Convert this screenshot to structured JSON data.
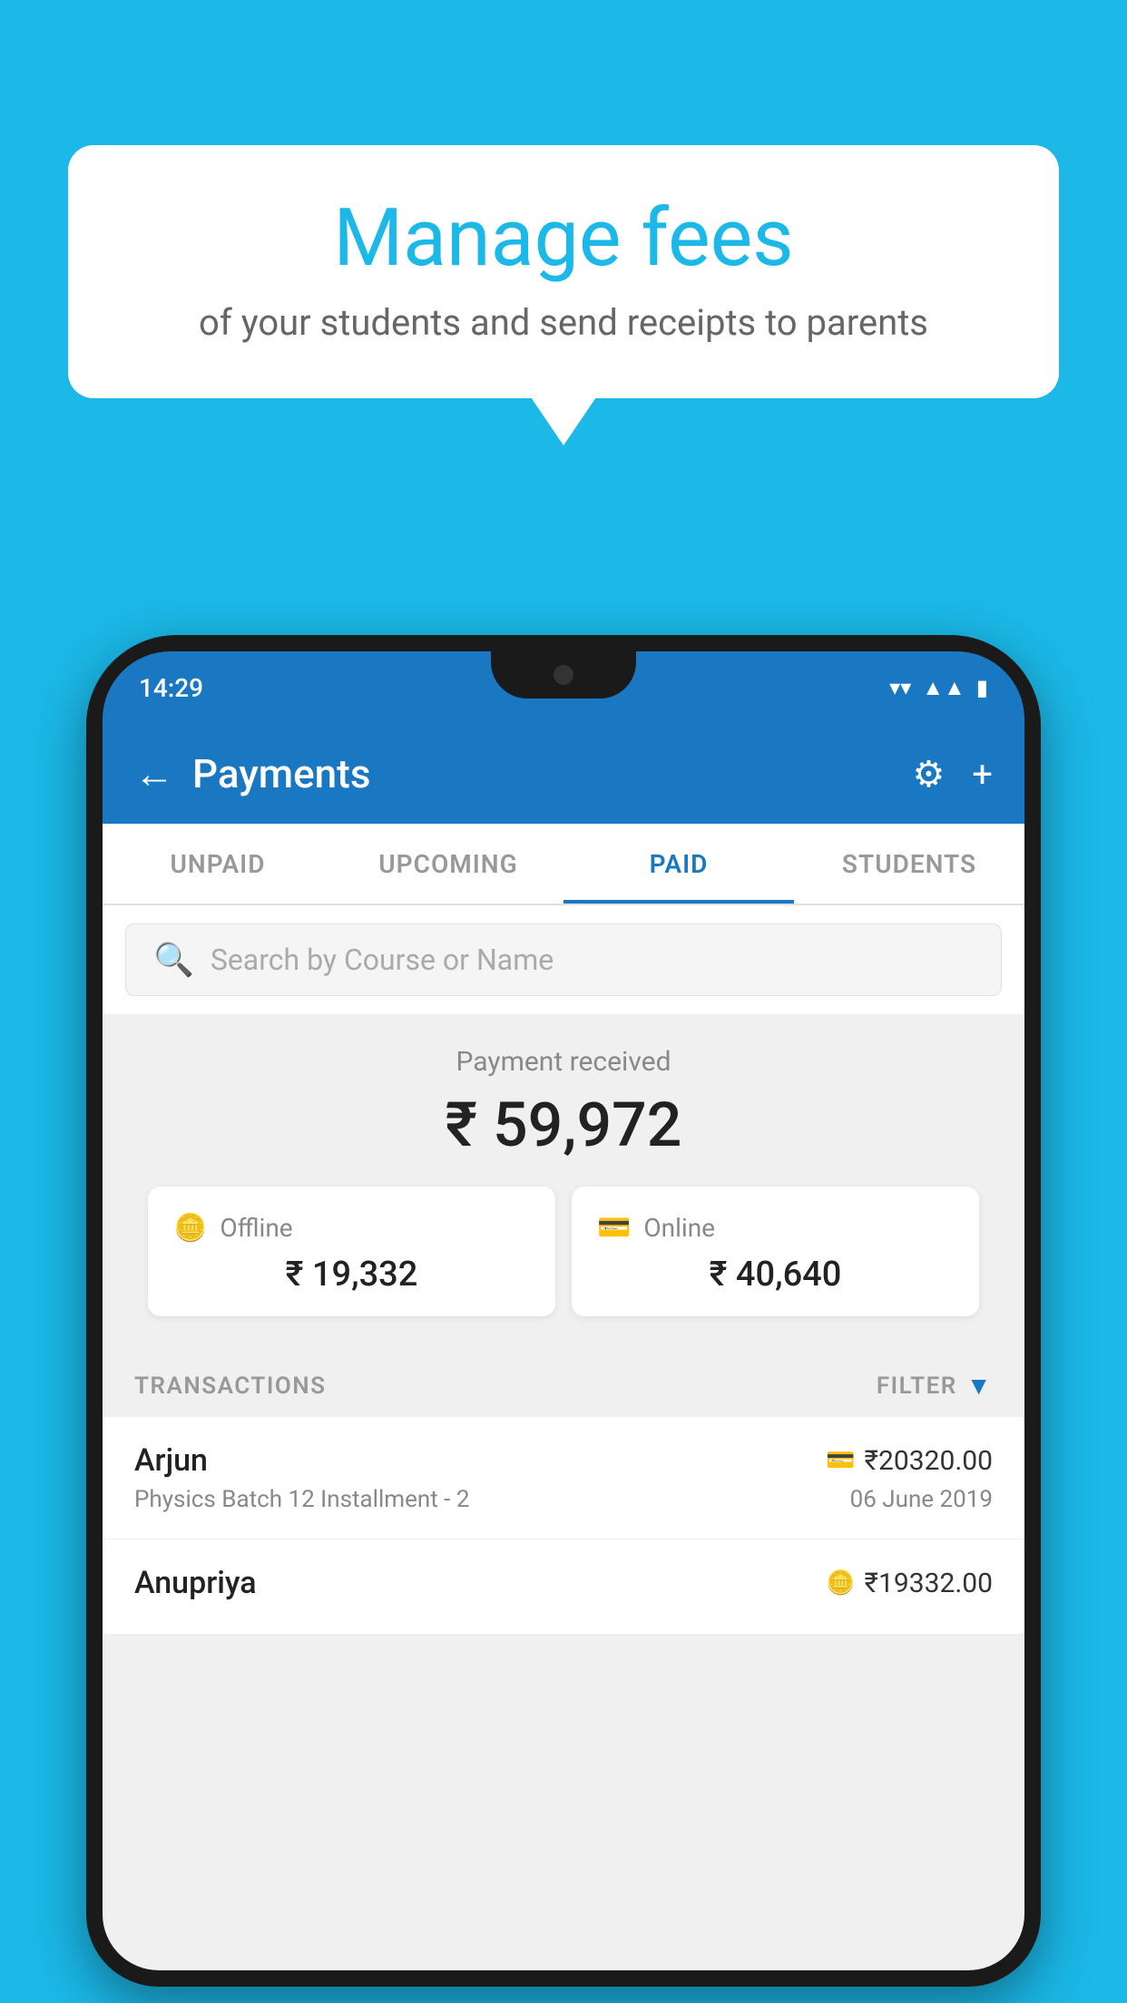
{
  "background_color": "#1BB8E8",
  "speech_bubble": {
    "title": "Manage fees",
    "subtitle": "of your students and send receipts to parents"
  },
  "phone": {
    "status_bar": {
      "time": "14:29"
    },
    "app_bar": {
      "title": "Payments",
      "back_label": "←",
      "gear_label": "⚙",
      "plus_label": "+"
    },
    "tabs": [
      {
        "label": "UNPAID",
        "active": false
      },
      {
        "label": "UPCOMING",
        "active": false
      },
      {
        "label": "PAID",
        "active": true
      },
      {
        "label": "STUDENTS",
        "active": false
      }
    ],
    "search": {
      "placeholder": "Search by Course or Name"
    },
    "payment_received": {
      "label": "Payment received",
      "amount": "₹ 59,972"
    },
    "payment_cards": [
      {
        "type": "Offline",
        "icon": "rupee-card",
        "amount": "₹ 19,332"
      },
      {
        "type": "Online",
        "icon": "credit-card",
        "amount": "₹ 40,640"
      }
    ],
    "transactions_label": "TRANSACTIONS",
    "filter_label": "FILTER",
    "transactions": [
      {
        "name": "Arjun",
        "amount": "₹20320.00",
        "payment_type": "card",
        "course": "Physics Batch 12 Installment - 2",
        "date": "06 June 2019"
      },
      {
        "name": "Anupriya",
        "amount": "₹19332.00",
        "payment_type": "cash",
        "course": "",
        "date": ""
      }
    ]
  }
}
